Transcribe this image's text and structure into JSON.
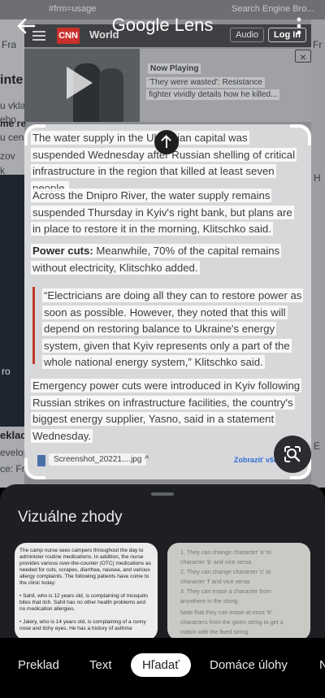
{
  "app": {
    "title": "Google Lens",
    "back_icon": "arrow-left-icon",
    "more_icon": "more-vert-icon"
  },
  "background_page": {
    "top_strip_text": "#frm=usage",
    "top_strip_search": "Search Engine Bro...",
    "site_logo": "CNN",
    "site_section": "World",
    "audio_label": "Audio",
    "login_label": "Log In",
    "now_playing_label": "Now Playing",
    "now_playing_line1": "'They were wasted': Resistance",
    "now_playing_line2": "fighter vividly details how he killed...",
    "left_fragments": [
      "Fra",
      "inte",
      "u vkla",
      "ebo",
      "me re",
      "u cen",
      "zov",
      "k",
      "ro",
      "eklac",
      "evelop",
      "ce: Fr"
    ],
    "right_fragments": [
      "Fr",
      "H",
      "E"
    ]
  },
  "selection": {
    "paragraph1": "The water supply in the Ukrainian capital was suspended Wednesday after Russian shelling of critical infrastructure in the region that killed at least seven people.",
    "paragraph2": "Across the Dnipro River, the water supply remains suspended Thursday in Kyiv's right bank, but plans are in place to restore it in the morning, Klitschko said.",
    "paragraph3_bold": "Power cuts:",
    "paragraph3_rest": " Meanwhile, 70% of the capital remains without electricity, Klitschko added.",
    "quote": "“Electricians are doing all they can to restore power as soon as possible. However, they noted that this will depend on restoring balance to Ukraine's energy system, given that Kyiv represents only a part of the whole national energy system,” Klitschko said.",
    "paragraph5": "Emergency power cuts were introduced in Kyiv following Russian strikes on infrastructure facilities, the country's biggest energy supplier, Yasno, said in a statement Wednesday.",
    "file_name": "Screenshot_20221....jpg",
    "file_action": "Zobraziť vše",
    "upload_icon": "arrow-up-icon",
    "lens_search_icon": "lens-search-icon"
  },
  "sheet": {
    "title": "Vizuálne zhody",
    "card1_lines": [
      "The camp nurse sees campers throughout the day to",
      "administer routine medications. In addition, the nurse",
      "provides various over-the-counter (OTC) medications as",
      "needed for cuts, scrapes, diarrhea, nausea, and various",
      "allergy complaints. The following patients have come to",
      "the clinic today:",
      "",
      "• Sahil, who is 12 years old, is complaining of mosquito",
      "  bites that itch. Sahil has no other health problems and",
      "  no medication allergies.",
      "",
      "• Jalery, who is 14 years old, is complaining of a runny",
      "  nose and itchy eyes. He has a history of asthma"
    ],
    "card2_lines": [
      "1. They can change character 'a' to",
      "   character 'b' and vice versa.",
      "2. They can change character 'c' to",
      "   character 'f' and vice versa.",
      "3. They can erase a character from",
      "   anywhere in the string.",
      "Note that they can erase at most 'K'",
      "characters from the given string to get a",
      "match with the fixed string."
    ]
  },
  "tabs": [
    "Preklad",
    "Text",
    "Hľadať",
    "Domáce úlohy",
    "N"
  ],
  "active_tab": "Hľadať",
  "colors": {
    "accent_link": "#2f6fd6",
    "sheet_bg": "#1e1f22",
    "quote_bar": "#c0392b"
  }
}
